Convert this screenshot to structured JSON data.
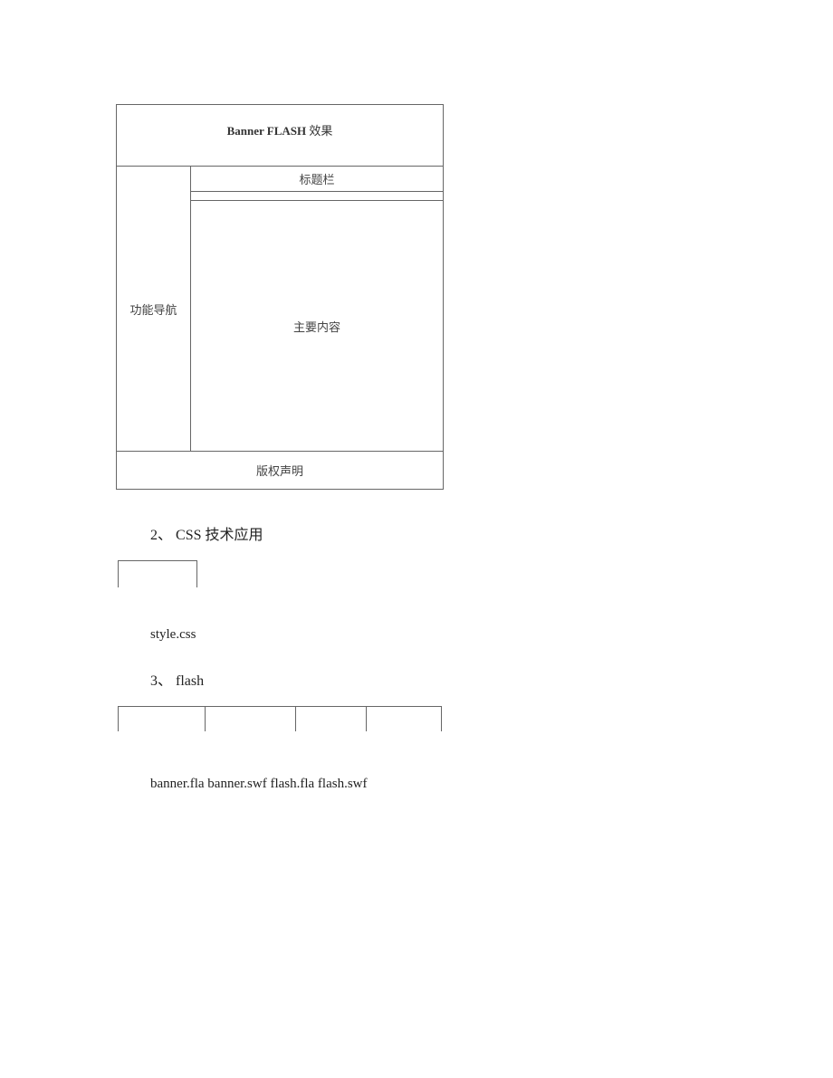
{
  "diagram": {
    "banner_bold": "Banner FLASH",
    "banner_rest": " 效果",
    "nav": "功能导航",
    "title_bar": "标题栏",
    "content": "主要内容",
    "footer": "版权声明"
  },
  "sections": {
    "s2_num": "2、",
    "s2_text": " CSS 技术应用",
    "css_file": "style.css",
    "s3_num": "3、",
    "s3_text": " flash",
    "flash_files": "banner.fla banner.swf flash.fla flash.swf"
  }
}
